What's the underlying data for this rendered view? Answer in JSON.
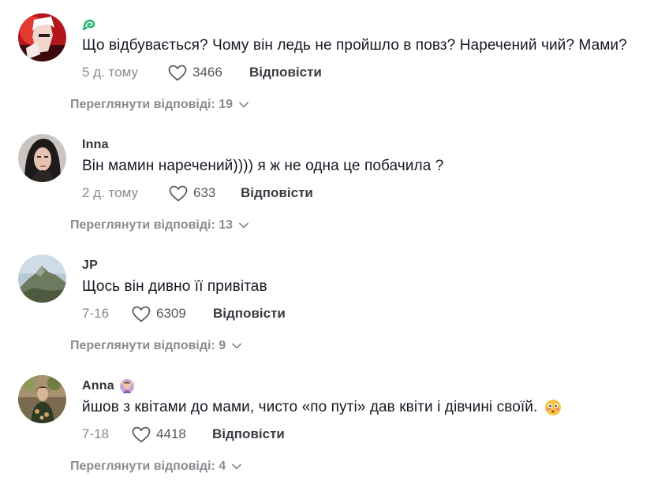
{
  "comments": [
    {
      "author": "",
      "text": "Що відбувається? Чому він ледь не пройшло в повз? Наречений чий? Мами?",
      "timestamp": "5 д. тому",
      "likes": "3466",
      "reply_label": "Відповісти",
      "view_replies_label": "Переглянути відповіді:",
      "reply_count": "19"
    },
    {
      "author": "Inna",
      "text": "Він мамин наречений)))) я ж не одна це побачила ?",
      "timestamp": "2 д. тому",
      "likes": "633",
      "reply_label": "Відповісти",
      "view_replies_label": "Переглянути відповіді:",
      "reply_count": "13"
    },
    {
      "author": "JP",
      "text": "Щось він дивно її привітав",
      "timestamp": "7-16",
      "likes": "6309",
      "reply_label": "Відповісти",
      "view_replies_label": "Переглянути відповіді:",
      "reply_count": "9"
    },
    {
      "author": "Anna",
      "text": "йшов з квітами до мами, чисто «по путі» дав квіти і дівчині своїй.",
      "timestamp": "7-18",
      "likes": "4418",
      "reply_label": "Відповісти",
      "view_replies_label": "Переглянути відповіді:",
      "reply_count": "4"
    }
  ],
  "icons": {
    "like": "heart-outline-icon",
    "expand": "chevron-down-icon",
    "author_badge_1": "green-swirl-icon",
    "author_badge_4": "woman-gesturing-emoji",
    "text_emoji_4": "flushed-face-emoji"
  },
  "colors": {
    "text": "#161823",
    "muted": "#8a8b91",
    "reply": "#3a3b42",
    "badge_green": "#22b573"
  }
}
